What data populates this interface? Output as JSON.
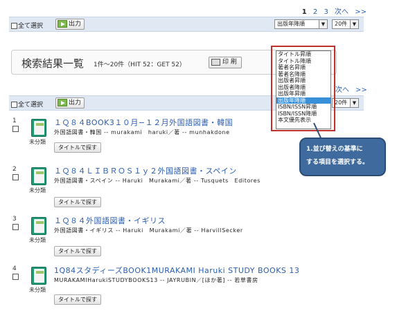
{
  "pager": {
    "current": "1",
    "p2": "2",
    "p3": "3",
    "next": "次へ",
    "last": ">>"
  },
  "toolbar": {
    "select_all": "全て選択",
    "output": "出力",
    "sort_value": "出版年降順",
    "count_value": "20件"
  },
  "results": {
    "title": "検索結果一覧",
    "count": "1件〜20件（HIT 52：GET 52）",
    "print": "印 刷"
  },
  "sort_options": [
    "タイトル昇順",
    "タイトル降順",
    "著者名昇順",
    "著者名降順",
    "出版者昇順",
    "出版者降順",
    "出版年昇順",
    "出版年降順",
    "ISBN/ISSN昇順",
    "ISBN/ISSN降順",
    "本文優先表示"
  ],
  "sort_selected": "出版年降順",
  "callout": {
    "line1": "1.並び替えの基準に",
    "line2": "する項目を選択する。"
  },
  "records": [
    {
      "num": "1",
      "title": "１Ｑ８４BOOK3１０月−１２月外国語図書・韓国",
      "sub": "外国語図書・韓国 -- murakami　haruki／著 -- munhakdone",
      "category": "未分類",
      "button": "タイトルで探す"
    },
    {
      "num": "2",
      "title": "１Ｑ８４ＬＩＢＲＯＳ１ｙ２外国語図書・スペイン",
      "sub": "外国語図書・スペイン -- Haruki　Murakami／著 -- Tusquets　Editores",
      "category": "未分類",
      "button": "タイトルで探す"
    },
    {
      "num": "3",
      "title": "１Ｑ８４外国語図書・イギリス",
      "sub": "外国語図書・イギリス -- Haruki　Murakami／著 -- HarvillSecker",
      "category": "未分類",
      "button": "タイトルで探す"
    },
    {
      "num": "4",
      "title": "1Q84スタディーズBOOK1MURAKAMI Haruki STUDY BOOKS 13",
      "sub": "MURAKAMIHarukiSTUDYBOOKS13 -- JAYRUBIN／[ほか著] -- 若草書房",
      "category": "未分類",
      "button": "タイトルで探す"
    }
  ]
}
